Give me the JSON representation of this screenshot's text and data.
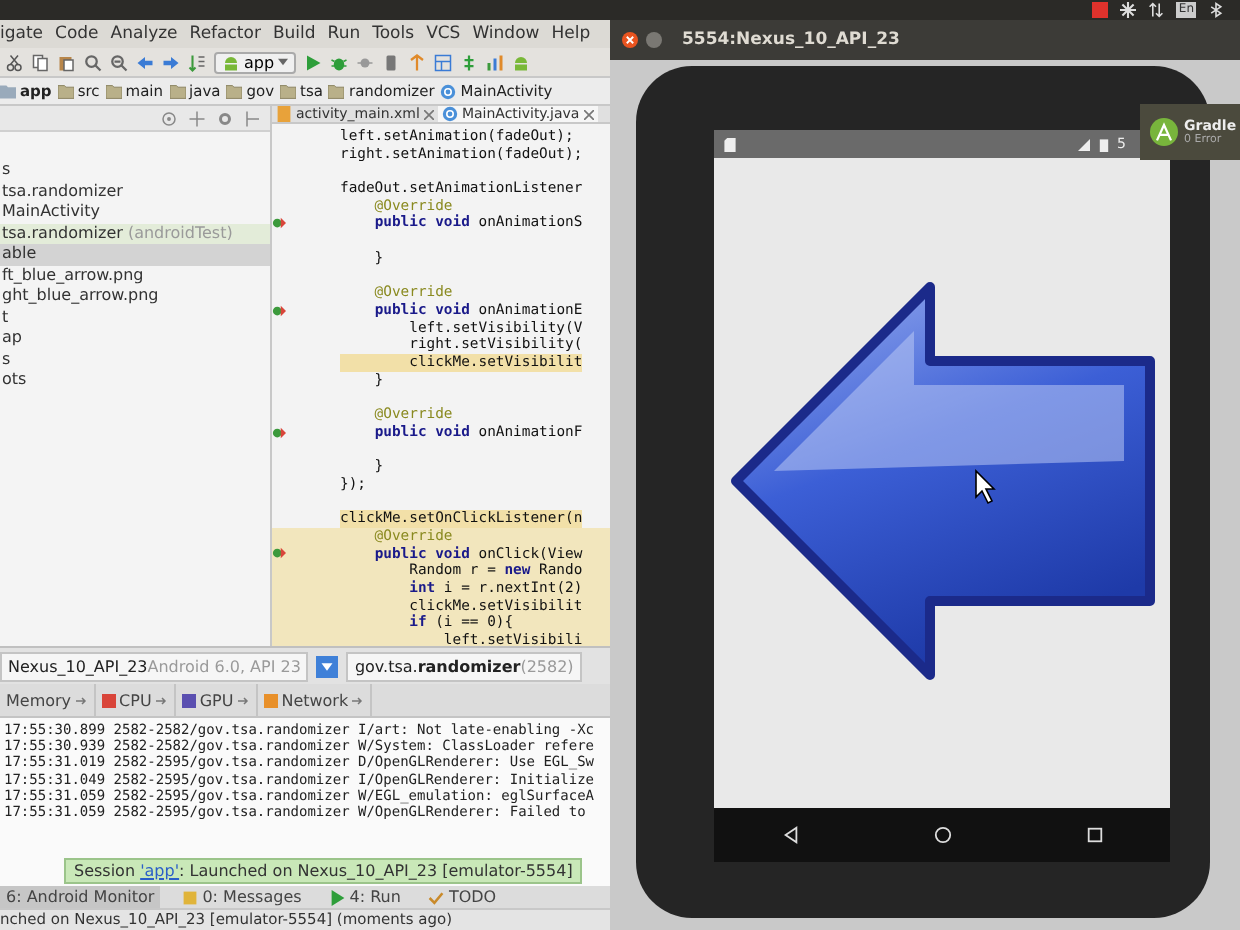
{
  "system_tray": {
    "language": "En"
  },
  "ide": {
    "menu": [
      "igate",
      "Code",
      "Analyze",
      "Refactor",
      "Build",
      "Run",
      "Tools",
      "VCS",
      "Window",
      "Help"
    ],
    "run_config": "app",
    "breadcrumb": [
      {
        "label": "app",
        "kind": "module"
      },
      {
        "label": "src",
        "kind": "folder"
      },
      {
        "label": "main",
        "kind": "folder"
      },
      {
        "label": "java",
        "kind": "folder"
      },
      {
        "label": "gov",
        "kind": "folder"
      },
      {
        "label": "tsa",
        "kind": "folder"
      },
      {
        "label": "randomizer",
        "kind": "folder"
      },
      {
        "label": "MainActivity",
        "kind": "class"
      }
    ],
    "project_tree": [
      {
        "label": "s",
        "kind": "folder",
        "selected": false
      },
      {
        "label": "tsa.randomizer",
        "kind": "package",
        "selected": false
      },
      {
        "label": "MainActivity",
        "kind": "class",
        "selected": false
      },
      {
        "label": "tsa.randomizer",
        "note": "(androidTest)",
        "kind": "test",
        "selected": false
      },
      {
        "label": "able",
        "kind": "folder",
        "selected": true
      },
      {
        "label": "ft_blue_arrow.png",
        "kind": "image",
        "selected": false
      },
      {
        "label": "ght_blue_arrow.png",
        "kind": "image",
        "selected": false
      },
      {
        "label": "t",
        "kind": "folder",
        "selected": false
      },
      {
        "label": "ap",
        "kind": "folder",
        "selected": false
      },
      {
        "label": "s",
        "kind": "folder",
        "selected": false
      },
      {
        "label": "ots",
        "kind": "folder",
        "selected": false
      }
    ],
    "editor_tabs": [
      {
        "label": "activity_main.xml",
        "kind": "xml",
        "selected": false
      },
      {
        "label": "MainActivity.java",
        "kind": "class",
        "selected": true
      }
    ],
    "code_lines": [
      {
        "kind": "code",
        "text": "left.setAnimation(fadeOut);",
        "highlighted": false,
        "block": false,
        "marker": false
      },
      {
        "kind": "code",
        "text": "right.setAnimation(fadeOut);",
        "highlighted": false,
        "block": false,
        "marker": false
      },
      {
        "kind": "blank",
        "block": false,
        "marker": false
      },
      {
        "kind": "code",
        "text": "fadeOut.setAnimationListener",
        "highlighted": false,
        "block": false,
        "marker": false
      },
      {
        "kind": "annotation",
        "text": "    @Override",
        "highlighted": false,
        "block": false,
        "marker": false
      },
      {
        "kind": "code",
        "text": "    **public void** onAnimationS",
        "highlighted": false,
        "block": false,
        "marker": true
      },
      {
        "kind": "blank",
        "block": false,
        "marker": false
      },
      {
        "kind": "code",
        "text": "    }",
        "highlighted": false,
        "block": false,
        "marker": false
      },
      {
        "kind": "blank",
        "block": false,
        "marker": false
      },
      {
        "kind": "annotation",
        "text": "    @Override",
        "highlighted": false,
        "block": false,
        "marker": false
      },
      {
        "kind": "code",
        "text": "    **public void** onAnimationE",
        "highlighted": false,
        "block": false,
        "marker": true
      },
      {
        "kind": "code",
        "text": "        left.setVisibility(V",
        "highlighted": false,
        "block": false,
        "marker": false
      },
      {
        "kind": "code",
        "text": "        right.setVisibility(",
        "highlighted": false,
        "block": false,
        "marker": false
      },
      {
        "kind": "code",
        "text": "        clickMe.setVisibilit",
        "highlighted": true,
        "block": false,
        "marker": false
      },
      {
        "kind": "code",
        "text": "    }",
        "highlighted": false,
        "block": false,
        "marker": false
      },
      {
        "kind": "blank",
        "block": false,
        "marker": false
      },
      {
        "kind": "annotation",
        "text": "    @Override",
        "highlighted": false,
        "block": false,
        "marker": false
      },
      {
        "kind": "code",
        "text": "    **public void** onAnimationF",
        "highlighted": false,
        "block": false,
        "marker": true
      },
      {
        "kind": "blank",
        "block": false,
        "marker": false
      },
      {
        "kind": "code",
        "text": "    }",
        "highlighted": false,
        "block": false,
        "marker": false
      },
      {
        "kind": "code",
        "text": "});",
        "highlighted": false,
        "block": false,
        "marker": false
      },
      {
        "kind": "blank",
        "block": false,
        "marker": false
      },
      {
        "kind": "code",
        "text": "clickMe.setOnClickListener(n",
        "highlighted": true,
        "block": false,
        "marker": false
      },
      {
        "kind": "annotation",
        "text": "    @Override",
        "highlighted": false,
        "block": true,
        "marker": false
      },
      {
        "kind": "code",
        "text": "    **public void** onClick(View",
        "highlighted": false,
        "block": true,
        "marker": true
      },
      {
        "kind": "code",
        "text": "        Random r = **new** Rando",
        "highlighted": false,
        "block": true,
        "marker": false
      },
      {
        "kind": "code",
        "text": "        **int** i = r.nextInt(2)",
        "highlighted": false,
        "block": true,
        "marker": false
      },
      {
        "kind": "code",
        "text": "        clickMe.setVisibilit",
        "highlighted": false,
        "block": true,
        "marker": false
      },
      {
        "kind": "code",
        "text": "        **if** (i == 0){",
        "highlighted": false,
        "block": true,
        "marker": false
      },
      {
        "kind": "code",
        "text": "            left.setVisibili",
        "highlighted": false,
        "block": true,
        "marker": false
      }
    ],
    "device": {
      "name": "Nexus_10_API_23",
      "detail": "Android 6.0, API 23"
    },
    "process": {
      "name": "gov.tsa.**randomizer**",
      "pid": "(2582)"
    },
    "monitor_tabs": [
      {
        "label": "Memory"
      },
      {
        "label": "CPU",
        "color": "#d9453a"
      },
      {
        "label": "GPU",
        "color": "#5a4fb0"
      },
      {
        "label": "Network",
        "color": "#e8902a"
      }
    ],
    "log_lines": [
      "17:55:30.899 2582-2582/gov.tsa.randomizer I/art: Not late-enabling -Xc",
      "17:55:30.939 2582-2582/gov.tsa.randomizer W/System: ClassLoader refere",
      "17:55:31.019 2582-2595/gov.tsa.randomizer D/OpenGLRenderer: Use EGL_Sw",
      "17:55:31.049 2582-2595/gov.tsa.randomizer I/OpenGLRenderer: Initialize",
      "17:55:31.059 2582-2595/gov.tsa.randomizer W/EGL_emulation: eglSurfaceA",
      "17:55:31.059 2582-2595/gov.tsa.randomizer W/OpenGLRenderer: Failed to"
    ],
    "session_balloon": {
      "prefix": "Session ",
      "link": "'app'",
      "suffix": ": Launched on Nexus_10_API_23 [emulator-5554]"
    },
    "tool_tabs": [
      {
        "label": "6: Android Monitor",
        "kind": "android",
        "selected": true
      },
      {
        "label": "0: Messages",
        "kind": "messages",
        "selected": false
      },
      {
        "label": "4: Run",
        "kind": "run",
        "selected": false
      },
      {
        "label": "TODO",
        "kind": "todo",
        "selected": false
      }
    ],
    "status_bar": "nched on Nexus_10_API_23 [emulator-5554] (moments ago)"
  },
  "emulator": {
    "title": "5554:Nexus_10_API_23",
    "status_clock": "5"
  },
  "notification": {
    "title": "Gradle",
    "body": "0 Error"
  }
}
